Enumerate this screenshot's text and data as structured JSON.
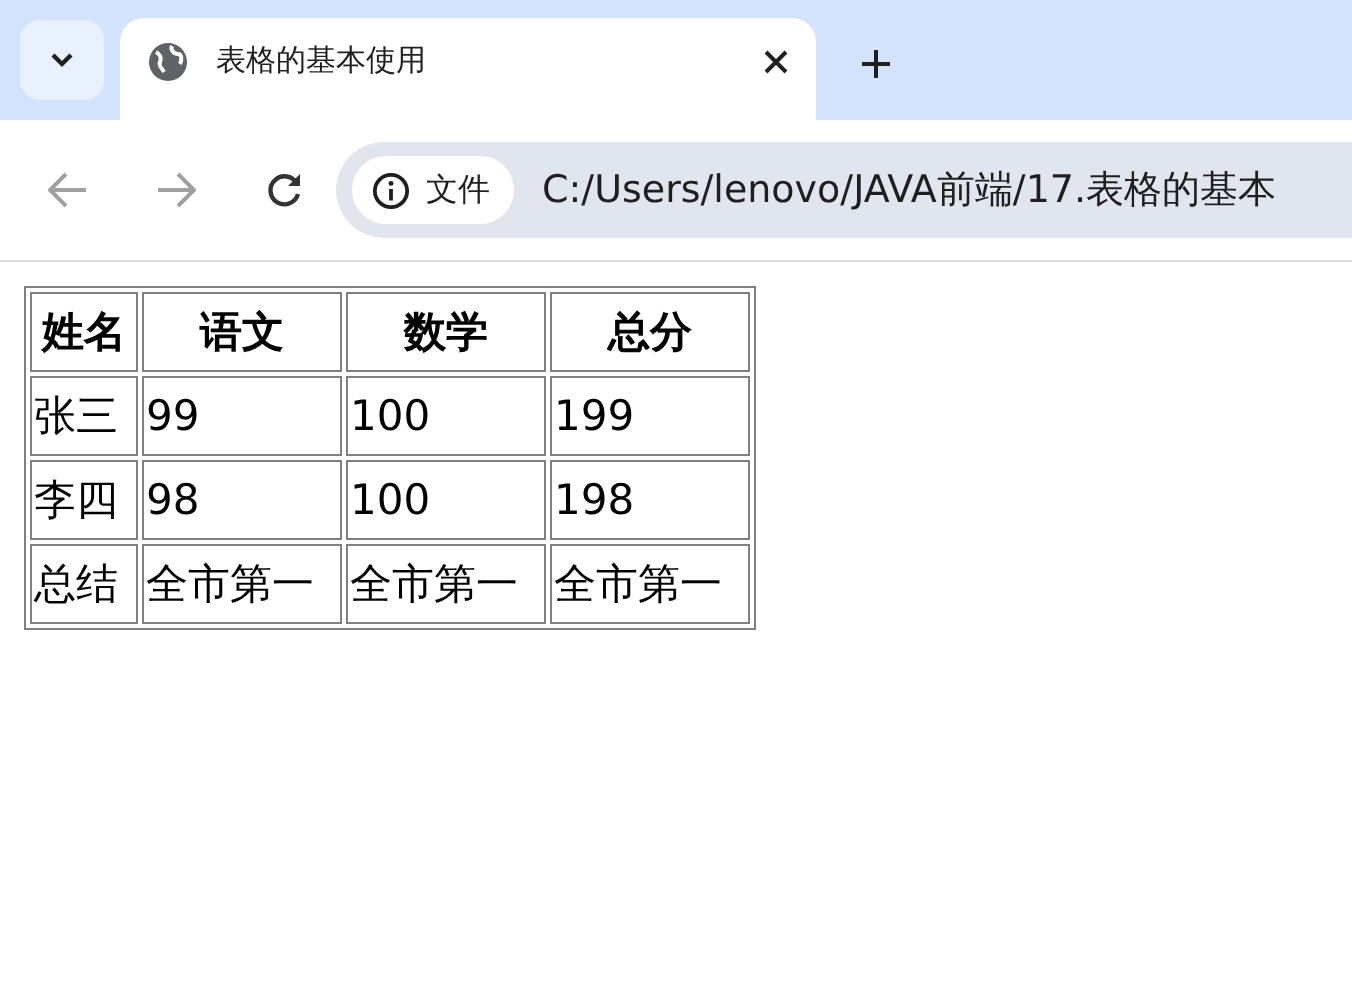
{
  "tabs": [
    {
      "title": "表格的基本使用",
      "selected": true
    }
  ],
  "address_bar": {
    "info_label": "文件",
    "url": "C:/Users/lenovo/JAVA前端/17.表格的基本"
  },
  "table": {
    "columns": [
      "姓名",
      "语文",
      "数学",
      "总分"
    ],
    "rows": [
      [
        "张三",
        "99",
        "100",
        "199"
      ],
      [
        "李四",
        "98",
        "100",
        "198"
      ],
      [
        "总结",
        "全市第一",
        "全市第一",
        "全市第一"
      ]
    ]
  }
}
